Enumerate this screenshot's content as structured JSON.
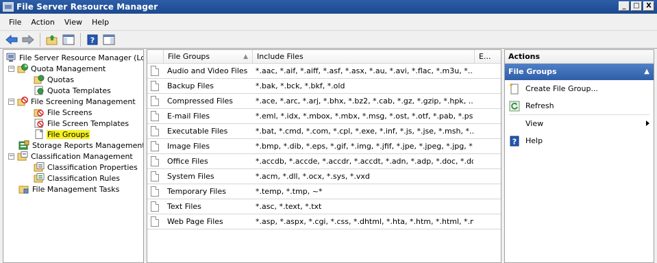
{
  "window": {
    "title": "File Server Resource Manager",
    "minimize": "_",
    "maximize": "□",
    "close": "X"
  },
  "menu": [
    "File",
    "Action",
    "View",
    "Help"
  ],
  "toolbar": {
    "icons": [
      "back-arrow-icon",
      "forward-arrow-icon",
      "up-folder-icon",
      "show-hide-tree-icon",
      "help-icon",
      "show-hide-action-pane-icon"
    ]
  },
  "tree": {
    "toggles": {
      "expanded": "−"
    },
    "items": [
      {
        "label": "File Server Resource Manager (Local)",
        "icon": "server-icon"
      },
      {
        "label": "Quota Management",
        "icon": "quota-management-icon"
      },
      {
        "label": "Quotas",
        "icon": "quota-icon"
      },
      {
        "label": "Quota Templates",
        "icon": "quota-template-icon"
      },
      {
        "label": "File Screening Management",
        "icon": "file-screening-icon"
      },
      {
        "label": "File Screens",
        "icon": "file-screen-icon"
      },
      {
        "label": "File Screen Templates",
        "icon": "file-screen-template-icon"
      },
      {
        "label": "File Groups",
        "icon": "file-group-icon",
        "selected": true
      },
      {
        "label": "Storage Reports Management",
        "icon": "storage-reports-icon"
      },
      {
        "label": "Classification Management",
        "icon": "classification-icon"
      },
      {
        "label": "Classification Properties",
        "icon": "classification-properties-icon"
      },
      {
        "label": "Classification Rules",
        "icon": "classification-rules-icon"
      },
      {
        "label": "File Management Tasks",
        "icon": "file-management-tasks-icon"
      }
    ]
  },
  "list": {
    "columns": [
      "File Groups",
      "Include Files",
      "E..."
    ],
    "rows": [
      {
        "name": "Audio and Video Files",
        "include": "*.aac, *.aif, *.aiff, *.asf, *.asx, *.au, *.avi, *.flac, *.m3u, *..."
      },
      {
        "name": "Backup Files",
        "include": "*.bak, *.bck, *.bkf, *.old"
      },
      {
        "name": "Compressed Files",
        "include": "*.ace, *.arc, *.arj, *.bhx, *.bz2, *.cab, *.gz, *.gzip, *.hpk, ..."
      },
      {
        "name": "E-mail Files",
        "include": "*.eml, *.idx, *.mbox, *.mbx, *.msg, *.ost, *.otf, *.pab, *.pst"
      },
      {
        "name": "Executable Files",
        "include": "*.bat, *.cmd, *.com, *.cpl, *.exe, *.inf, *.js, *.jse, *.msh, *...."
      },
      {
        "name": "Image Files",
        "include": "*.bmp, *.dib, *.eps, *.gif, *.img, *.jfif, *.jpe, *.jpeg, *.jpg, *..."
      },
      {
        "name": "Office Files",
        "include": "*.accdb, *.accde, *.accdr, *.accdt, *.adn, *.adp, *.doc, *.do..."
      },
      {
        "name": "System Files",
        "include": "*.acm, *.dll, *.ocx, *.sys, *.vxd"
      },
      {
        "name": "Temporary Files",
        "include": "*.temp, *.tmp, ~*"
      },
      {
        "name": "Text Files",
        "include": "*.asc, *.text, *.txt"
      },
      {
        "name": "Web Page Files",
        "include": "*.asp, *.aspx, *.cgi, *.css, *.dhtml, *.hta, *.htm, *.html, *.m..."
      }
    ]
  },
  "actions": {
    "title": "Actions",
    "section": "File Groups",
    "items": [
      {
        "label": "Create File Group...",
        "icon": "create-file-group-icon"
      },
      {
        "label": "Refresh",
        "icon": "refresh-icon"
      },
      {
        "label": "View",
        "icon": ""
      },
      {
        "label": "Help",
        "icon": "help-icon"
      }
    ]
  },
  "colors": {
    "titlebar": "#1c4a8f",
    "selection_highlight": "#f5f21d",
    "actions_section": "#2f5fa8"
  }
}
